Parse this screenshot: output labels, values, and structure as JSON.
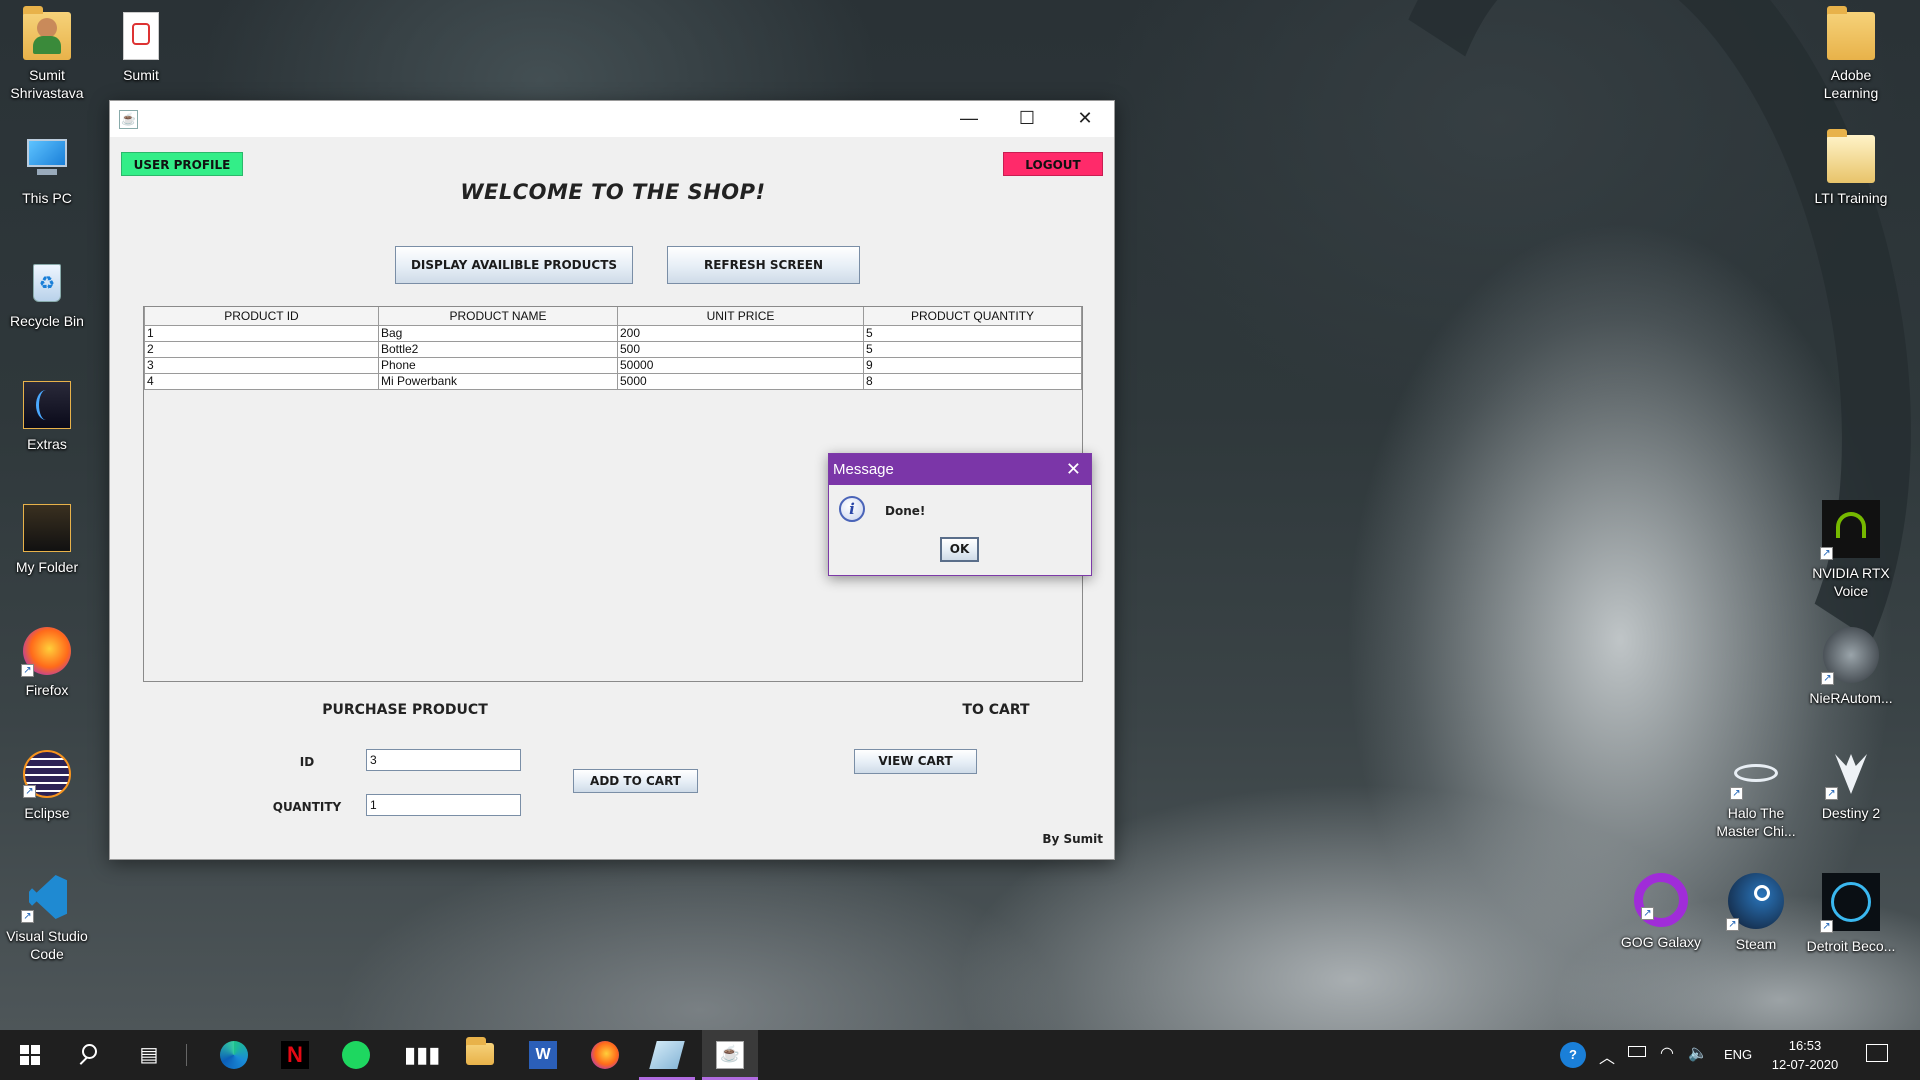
{
  "desktop": {
    "left_icons": [
      {
        "label": "Sumit Shrivastava",
        "icon": "user-folder-icon"
      },
      {
        "label": "Sumit Resume...",
        "icon": "pdf-file-icon"
      },
      {
        "label": "This PC",
        "icon": "computer-icon"
      },
      {
        "label": "Recycle Bin",
        "icon": "recycle-bin-icon"
      },
      {
        "label": "Extras",
        "icon": "folder-icon"
      },
      {
        "label": "My Folder",
        "icon": "folder-icon"
      },
      {
        "label": "Firefox",
        "icon": "firefox-icon"
      },
      {
        "label": "Eclipse",
        "icon": "eclipse-icon"
      },
      {
        "label": "Visual Studio Code",
        "icon": "vscode-icon"
      }
    ],
    "right_icons": [
      {
        "label": "Adobe Learning",
        "icon": "folder-icon"
      },
      {
        "label": "LTI Training",
        "icon": "folder-icon"
      },
      {
        "label": "NVIDIA RTX Voice",
        "icon": "nvidia-icon"
      },
      {
        "label": "NieRAutom...",
        "icon": "game-icon"
      },
      {
        "label": "Halo The Master Chi...",
        "icon": "halo-icon"
      },
      {
        "label": "Destiny 2",
        "icon": "destiny-icon"
      },
      {
        "label": "GOG Galaxy",
        "icon": "gog-icon"
      },
      {
        "label": "Steam",
        "icon": "steam-icon"
      },
      {
        "label": "Detroit Beco...",
        "icon": "detroit-icon"
      }
    ]
  },
  "app": {
    "user_profile_label": "USER PROFILE",
    "logout_label": "LOGOUT",
    "title": "WELCOME TO THE SHOP!",
    "display_products_label": "DISPLAY AVAILIBLE PRODUCTS",
    "refresh_label": "REFRESH SCREEN",
    "table": {
      "headers": [
        "PRODUCT ID",
        "PRODUCT NAME",
        "UNIT PRICE",
        "PRODUCT QUANTITY"
      ],
      "rows": [
        [
          "1",
          "Bag",
          "200",
          "5"
        ],
        [
          "2",
          "Bottle2",
          "500",
          "5"
        ],
        [
          "3",
          "Phone",
          "50000",
          "9"
        ],
        [
          "4",
          "Mi Powerbank",
          "5000",
          "8"
        ]
      ]
    },
    "purchase_heading": "PURCHASE PRODUCT",
    "id_label": "ID",
    "id_value": "3",
    "quantity_label": "QUANTITY",
    "quantity_value": "1",
    "add_to_cart_label": "ADD TO CART",
    "to_cart_heading": "TO CART",
    "view_cart_label": "VIEW CART",
    "footer": "By Sumit",
    "colors": {
      "user_profile": "#33ee88",
      "logout": "#ff2a6a"
    }
  },
  "dialog": {
    "title": "Message",
    "message": "Done!",
    "ok_label": "OK",
    "title_color": "#7b36a8"
  },
  "taskbar": {
    "apps": [
      "start-icon",
      "search-icon",
      "task-view-icon",
      "edge-icon",
      "netflix-icon",
      "spotify-icon",
      "audio-icon",
      "file-explorer-icon",
      "word-icon",
      "firefox-icon",
      "notes-icon",
      "java-icon"
    ],
    "language": "ENG",
    "time": "16:53",
    "date": "12-07-2020"
  }
}
